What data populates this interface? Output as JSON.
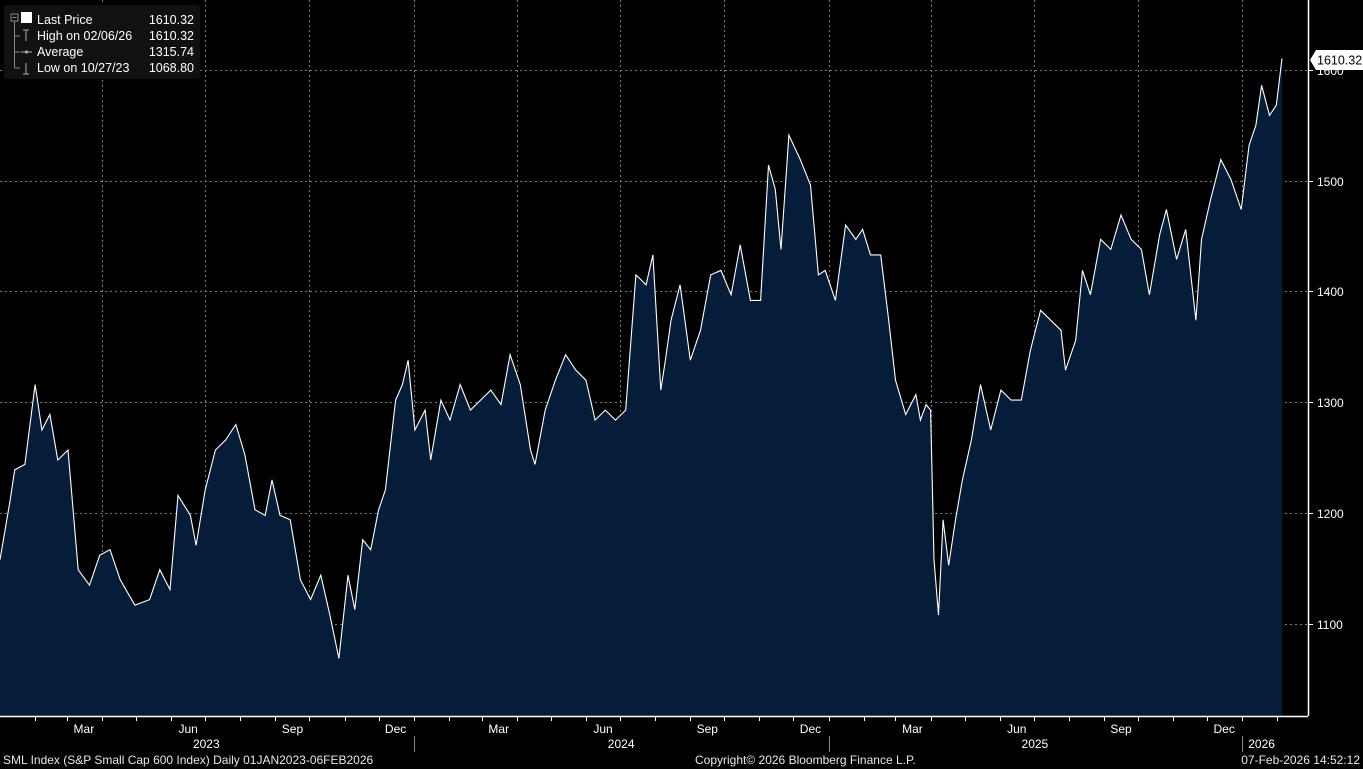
{
  "legend": {
    "last_price_label": "Last Price",
    "last_price_value": "1610.32",
    "high_label": "High on 02/06/26",
    "high_value": "1610.32",
    "average_label": "Average",
    "average_value": "1315.74",
    "low_label": "Low on 10/27/23",
    "low_value": "1068.80"
  },
  "last_price_tag": "1610.32",
  "footer": {
    "left": "SML Index (S&P Small Cap 600 Index) Daily 01JAN2023-06FEB2026",
    "center": "Copyright© 2026 Bloomberg Finance L.P.",
    "right": "07-Feb-2026 14:52:12"
  },
  "colors": {
    "fill": "#061d39",
    "line": "#ffffff",
    "grid": "#7a7a7a"
  },
  "chart_data": {
    "type": "area",
    "title": "SML Index (S&P Small Cap 600 Index) Daily",
    "x_origin": "2023-01-01",
    "x_unit": "days since x_origin",
    "xlim": [
      0,
      1131
    ],
    "ylim": [
      1017,
      1663
    ],
    "y_ticks": [
      1100,
      1200,
      1300,
      1400,
      1500,
      1600
    ],
    "grid": true,
    "x_ticks": [
      {
        "label": "Mar",
        "date": "2023-03-16"
      },
      {
        "label": "Jun",
        "date": "2023-06-16"
      },
      {
        "label": "Sep",
        "date": "2023-09-16"
      },
      {
        "label": "Dec",
        "date": "2023-12-16"
      },
      {
        "label": "Mar",
        "date": "2024-03-16"
      },
      {
        "label": "Jun",
        "date": "2024-06-16"
      },
      {
        "label": "Sep",
        "date": "2024-09-16"
      },
      {
        "label": "Dec",
        "date": "2024-12-16"
      },
      {
        "label": "Mar",
        "date": "2025-03-16"
      },
      {
        "label": "Jun",
        "date": "2025-06-16"
      },
      {
        "label": "Sep",
        "date": "2025-09-16"
      },
      {
        "label": "Dec",
        "date": "2025-12-16"
      }
    ],
    "grid_dates": [
      "2023-04-01",
      "2023-07-01",
      "2023-10-01",
      "2024-01-01",
      "2024-04-01",
      "2024-07-01",
      "2024-10-01",
      "2025-01-01",
      "2025-04-01",
      "2025-07-01",
      "2025-10-01",
      "2026-01-01"
    ],
    "year_labels": [
      {
        "label": "2023",
        "date": "2023-07-02"
      },
      {
        "label": "2024",
        "date": "2024-07-02"
      },
      {
        "label": "2025",
        "date": "2025-07-02"
      },
      {
        "label": "2026",
        "date": "2026-01-18"
      }
    ],
    "year_separators": [
      "2024-01-01",
      "2025-01-01",
      "2026-01-01"
    ],
    "series": [
      {
        "name": "Last Price",
        "points": [
          [
            0,
            1158
          ],
          [
            9,
            1212
          ],
          [
            13,
            1239
          ],
          [
            22,
            1244
          ],
          [
            31,
            1316
          ],
          [
            37,
            1275
          ],
          [
            44,
            1289
          ],
          [
            51,
            1248
          ],
          [
            60,
            1257
          ],
          [
            69,
            1149
          ],
          [
            79,
            1135
          ],
          [
            88,
            1162
          ],
          [
            97,
            1167
          ],
          [
            106,
            1140
          ],
          [
            119,
            1117
          ],
          [
            132,
            1122
          ],
          [
            141,
            1149
          ],
          [
            150,
            1131
          ],
          [
            157,
            1216
          ],
          [
            168,
            1198
          ],
          [
            173,
            1171
          ],
          [
            181,
            1221
          ],
          [
            190,
            1257
          ],
          [
            199,
            1266
          ],
          [
            208,
            1280
          ],
          [
            216,
            1253
          ],
          [
            225,
            1203
          ],
          [
            234,
            1198
          ],
          [
            240,
            1230
          ],
          [
            247,
            1198
          ],
          [
            256,
            1194
          ],
          [
            265,
            1140
          ],
          [
            274,
            1122
          ],
          [
            283,
            1144
          ],
          [
            291,
            1108
          ],
          [
            299,
            1069
          ],
          [
            307,
            1144
          ],
          [
            313,
            1113
          ],
          [
            320,
            1176
          ],
          [
            327,
            1167
          ],
          [
            334,
            1203
          ],
          [
            340,
            1221
          ],
          [
            349,
            1302
          ],
          [
            355,
            1316
          ],
          [
            360,
            1338
          ],
          [
            366,
            1275
          ],
          [
            375,
            1293
          ],
          [
            380,
            1248
          ],
          [
            389,
            1302
          ],
          [
            397,
            1284
          ],
          [
            406,
            1316
          ],
          [
            415,
            1293
          ],
          [
            424,
            1302
          ],
          [
            433,
            1311
          ],
          [
            442,
            1298
          ],
          [
            450,
            1343
          ],
          [
            459,
            1316
          ],
          [
            468,
            1257
          ],
          [
            472,
            1244
          ],
          [
            481,
            1293
          ],
          [
            490,
            1320
          ],
          [
            499,
            1343
          ],
          [
            508,
            1329
          ],
          [
            517,
            1320
          ],
          [
            525,
            1284
          ],
          [
            534,
            1293
          ],
          [
            543,
            1284
          ],
          [
            552,
            1293
          ],
          [
            556,
            1347
          ],
          [
            561,
            1415
          ],
          [
            570,
            1406
          ],
          [
            576,
            1433
          ],
          [
            583,
            1311
          ],
          [
            587,
            1338
          ],
          [
            592,
            1374
          ],
          [
            600,
            1406
          ],
          [
            609,
            1338
          ],
          [
            618,
            1365
          ],
          [
            627,
            1415
          ],
          [
            636,
            1419
          ],
          [
            645,
            1397
          ],
          [
            653,
            1442
          ],
          [
            662,
            1392
          ],
          [
            671,
            1392
          ],
          [
            678,
            1514
          ],
          [
            684,
            1492
          ],
          [
            689,
            1438
          ],
          [
            696,
            1541
          ],
          [
            706,
            1519
          ],
          [
            715,
            1496
          ],
          [
            722,
            1415
          ],
          [
            728,
            1419
          ],
          [
            737,
            1392
          ],
          [
            746,
            1460
          ],
          [
            755,
            1447
          ],
          [
            761,
            1456
          ],
          [
            768,
            1433
          ],
          [
            777,
            1433
          ],
          [
            784,
            1374
          ],
          [
            790,
            1320
          ],
          [
            799,
            1289
          ],
          [
            808,
            1307
          ],
          [
            812,
            1284
          ],
          [
            817,
            1298
          ],
          [
            821,
            1293
          ],
          [
            824,
            1158
          ],
          [
            828,
            1108
          ],
          [
            832,
            1194
          ],
          [
            837,
            1153
          ],
          [
            843,
            1194
          ],
          [
            849,
            1230
          ],
          [
            857,
            1266
          ],
          [
            865,
            1316
          ],
          [
            874,
            1275
          ],
          [
            883,
            1311
          ],
          [
            892,
            1302
          ],
          [
            901,
            1302
          ],
          [
            909,
            1347
          ],
          [
            918,
            1383
          ],
          [
            927,
            1374
          ],
          [
            936,
            1365
          ],
          [
            940,
            1329
          ],
          [
            949,
            1356
          ],
          [
            955,
            1419
          ],
          [
            962,
            1397
          ],
          [
            971,
            1447
          ],
          [
            980,
            1438
          ],
          [
            989,
            1469
          ],
          [
            998,
            1447
          ],
          [
            1007,
            1438
          ],
          [
            1014,
            1397
          ],
          [
            1023,
            1451
          ],
          [
            1029,
            1474
          ],
          [
            1038,
            1429
          ],
          [
            1046,
            1456
          ],
          [
            1055,
            1374
          ],
          [
            1060,
            1447
          ],
          [
            1068,
            1483
          ],
          [
            1077,
            1519
          ],
          [
            1086,
            1501
          ],
          [
            1095,
            1474
          ],
          [
            1102,
            1532
          ],
          [
            1108,
            1550
          ],
          [
            1113,
            1586
          ],
          [
            1120,
            1559
          ],
          [
            1126,
            1568
          ],
          [
            1131,
            1610.32
          ]
        ]
      }
    ]
  }
}
